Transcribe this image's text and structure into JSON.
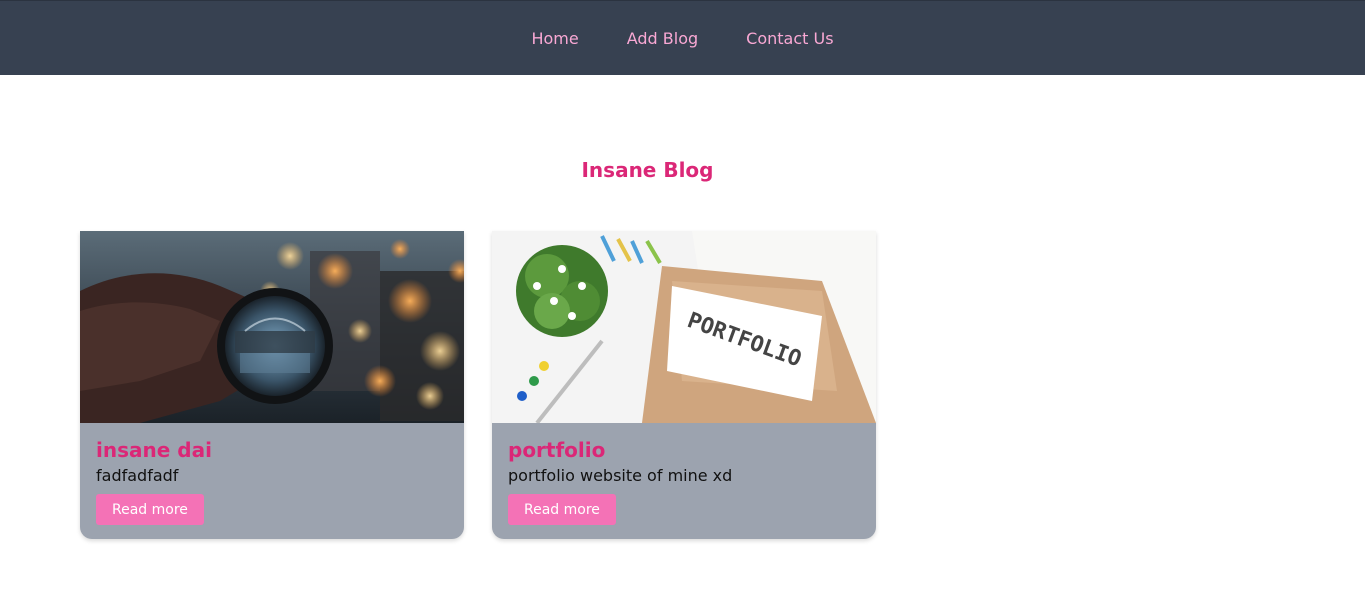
{
  "nav": {
    "links": [
      {
        "label": "Home"
      },
      {
        "label": "Add Blog"
      },
      {
        "label": "Contact Us"
      }
    ]
  },
  "page": {
    "title": "Insane Blog"
  },
  "posts": [
    {
      "title": "insane dai",
      "description": "fadfadfadf",
      "button_label": "Read more",
      "image": "city-lens-photo"
    },
    {
      "title": "portfolio",
      "description": "portfolio website of mine xd",
      "button_label": "Read more",
      "image": "portfolio-notebook-photo"
    }
  ],
  "colors": {
    "navbar_bg": "#374151",
    "nav_link": "#f9a8d4",
    "accent": "#db2777",
    "card_bg": "#9ca3af",
    "button_bg": "#f472b6"
  }
}
